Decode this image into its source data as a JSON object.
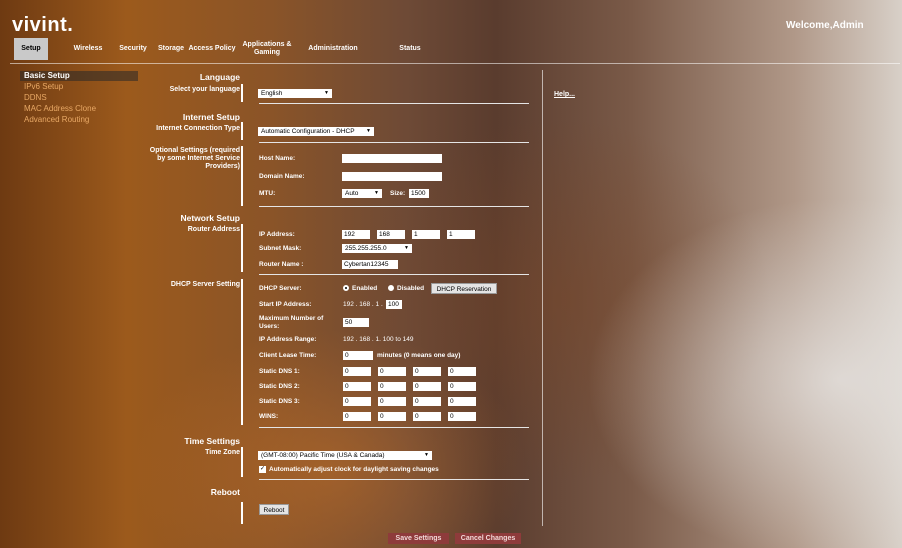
{
  "header": {
    "logo": "vivint.",
    "welcome": "Welcome,Admin"
  },
  "nav": {
    "tabs": [
      {
        "label": "Setup"
      },
      {
        "label": "Wireless"
      },
      {
        "label": "Security"
      },
      {
        "label": "Storage"
      },
      {
        "label": "Access Policy"
      },
      {
        "label": "Applications & Gaming"
      },
      {
        "label": "Administration"
      },
      {
        "label": "Status"
      }
    ]
  },
  "sidebar": {
    "items": [
      {
        "label": "Basic Setup"
      },
      {
        "label": "IPv6 Setup"
      },
      {
        "label": "DDNS"
      },
      {
        "label": "MAC Address Clone"
      },
      {
        "label": "Advanced Routing"
      }
    ]
  },
  "help": {
    "label": "Help..."
  },
  "language": {
    "section": "Language",
    "label": "Select your language",
    "value": "English"
  },
  "internet": {
    "section": "Internet Setup",
    "type_label": "Internet Connection Type",
    "type_value": "Automatic Configuration - DHCP",
    "optional_label": "Optional Settings (required by some Internet Service Providers)",
    "host_label": "Host Name:",
    "host_value": "",
    "domain_label": "Domain Name:",
    "domain_value": "",
    "mtu_label": "MTU:",
    "mtu_value": "Auto",
    "size_label": "Size:",
    "size_value": "1500"
  },
  "network": {
    "section": "Network Setup",
    "router_label": "Router Address",
    "ip_label": "IP Address:",
    "ip": [
      "192",
      "168",
      "1",
      "1"
    ],
    "subnet_label": "Subnet Mask:",
    "subnet_value": "255.255.255.0",
    "name_label": "Router Name :",
    "name_value": "Cybertan12345"
  },
  "dhcp": {
    "section": "DHCP Server Setting",
    "server_label": "DHCP Server:",
    "enabled": "Enabled",
    "disabled": "Disabled",
    "reservation_button": "DHCP Reservation",
    "start_label": "Start IP Address:",
    "start_prefix": "192 . 168 . 1 .",
    "start_value": "100",
    "max_label": "Maximum Number of Users:",
    "max_value": "50",
    "range_label": "IP Address Range:",
    "range_value": "192 . 168 . 1. 100 to 149",
    "lease_label": "Client Lease Time:",
    "lease_value": "0",
    "lease_suffix": "minutes (0 means one day)",
    "dns1_label": "Static DNS 1:",
    "dns1": [
      "0",
      "0",
      "0",
      "0"
    ],
    "dns2_label": "Static DNS 2:",
    "dns2": [
      "0",
      "0",
      "0",
      "0"
    ],
    "dns3_label": "Static DNS 3:",
    "dns3": [
      "0",
      "0",
      "0",
      "0"
    ],
    "wins_label": "WINS:",
    "wins": [
      "0",
      "0",
      "0",
      "0"
    ]
  },
  "time": {
    "section": "Time Settings",
    "zone_label": "Time Zone",
    "zone_value": "(GMT-08:00) Pacific Time (USA & Canada)",
    "dst_label": "Automatically adjust clock for daylight saving changes",
    "dst_mark": "✓"
  },
  "reboot": {
    "section": "Reboot",
    "button": "Reboot"
  },
  "actions": {
    "save": "Save Settings",
    "cancel": "Cancel Changes"
  },
  "icons": {
    "dropdown": "▼"
  }
}
